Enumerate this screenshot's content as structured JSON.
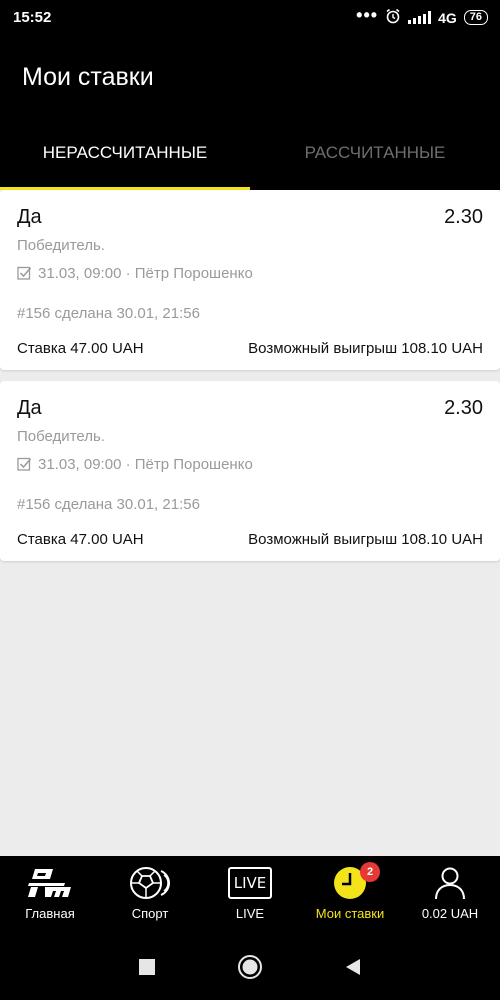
{
  "status_bar": {
    "time": "15:52",
    "network": "4G",
    "battery": "76"
  },
  "header": {
    "title": "Мои ставки",
    "tabs": [
      {
        "label": "НЕРАССЧИТАННЫЕ",
        "active": true
      },
      {
        "label": "РАССЧИТАННЫЕ",
        "active": false
      }
    ]
  },
  "bets": [
    {
      "selection": "Да",
      "odds": "2.30",
      "market": "Победитель.",
      "event": "31.03, 09:00 · Пётр Порошенко",
      "placed": "#156 сделана 30.01, 21:56",
      "stake": "Ставка 47.00 UAH",
      "possible_win": "Возможный выигрыш 108.10 UAH"
    },
    {
      "selection": "Да",
      "odds": "2.30",
      "market": "Победитель.",
      "event": "31.03, 09:00 · Пётр Порошенко",
      "placed": "#156 сделана 30.01, 21:56",
      "stake": "Ставка 47.00 UAH",
      "possible_win": "Возможный выигрыш 108.10 UAH"
    }
  ],
  "bottom_nav": [
    {
      "label": "Главная",
      "icon": "pm-logo-icon"
    },
    {
      "label": "Спорт",
      "icon": "balls-icon"
    },
    {
      "label": "LIVE",
      "icon": "live-icon",
      "icon_text": "LIVE"
    },
    {
      "label": "Мои ставки",
      "icon": "clock-icon",
      "active": true,
      "badge": "2"
    },
    {
      "label": "0.02 UAH",
      "icon": "user-icon"
    }
  ],
  "colors": {
    "accent": "#f2e31a",
    "badge": "#e53935",
    "background": "#000000",
    "content_bg": "#ececec"
  }
}
